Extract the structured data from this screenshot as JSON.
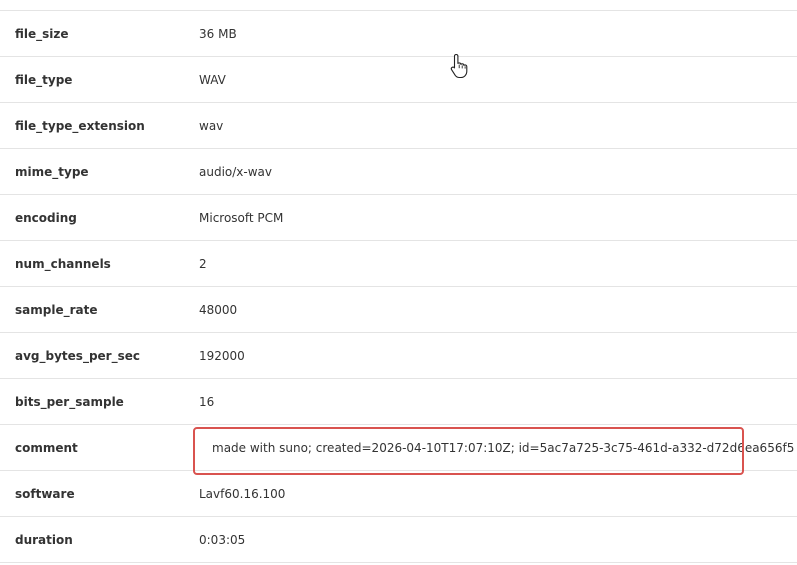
{
  "metadata": {
    "rows": [
      {
        "key": "file_size",
        "value": "36 MB"
      },
      {
        "key": "file_type",
        "value": "WAV"
      },
      {
        "key": "file_type_extension",
        "value": "wav"
      },
      {
        "key": "mime_type",
        "value": "audio/x-wav"
      },
      {
        "key": "encoding",
        "value": "Microsoft PCM"
      },
      {
        "key": "num_channels",
        "value": "2"
      },
      {
        "key": "sample_rate",
        "value": "48000"
      },
      {
        "key": "avg_bytes_per_sec",
        "value": "192000"
      },
      {
        "key": "bits_per_sample",
        "value": "16"
      },
      {
        "key": "comment",
        "value": "made with suno; created=2026-04-10T17:07:10Z; id=5ac7a725-3c75-461d-a332-d72d6ea656f5"
      },
      {
        "key": "software",
        "value": "Lavf60.16.100"
      },
      {
        "key": "duration",
        "value": "0:03:05"
      }
    ]
  },
  "colors": {
    "highlight_border": "#d9534f",
    "row_divider": "#e4e4e4"
  },
  "icons": {
    "cursor": "hand-pointer-icon"
  }
}
